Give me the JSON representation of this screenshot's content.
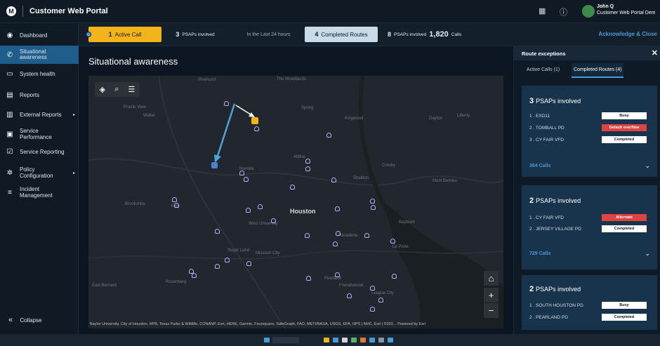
{
  "app": {
    "title": "Customer Web Portal"
  },
  "user": {
    "name": "John Q",
    "org": "Customer Web Portal Dem"
  },
  "sidebar": {
    "items": [
      {
        "label": "Dashboard"
      },
      {
        "label": "Situational awareness"
      },
      {
        "label": "System health"
      },
      {
        "label": "Reports"
      },
      {
        "label": "External Reports"
      },
      {
        "label": "Service Performance"
      },
      {
        "label": "Service Reporting"
      },
      {
        "label": "Policy Configuration"
      },
      {
        "label": "Incident Management"
      }
    ],
    "collapse_label": "Collapse"
  },
  "statusbar": {
    "active_count": "1",
    "active_label": "Active Call",
    "psaps_count": "3",
    "psaps_label": "PSAPs involved",
    "period": "In the Last 24 hours",
    "completed_count": "4",
    "completed_label": "Completed Routes",
    "completed_psaps_count": "8",
    "completed_psaps_label": "PSAPs involved",
    "calls_count": "1,820",
    "calls_label": "Calls",
    "acknowledge": "Acknowledge & Close"
  },
  "main": {
    "title": "Situational awareness"
  },
  "map": {
    "city_label": "Houston",
    "attribution": "Baylor University, City of Houston, HPB, Texas Parks & Wildlife, CONANP, Esri, HERE, Garmin, Foursquare, SafeGraph, FAO, METI/NASA, USGS, EPA, NPS | NHC, Esri | ©201... Powered by Esri",
    "labels": [
      "Pinehurst",
      "The Woodlands",
      "Prairie View",
      "Waller",
      "Spring",
      "Kingwood",
      "Dayton",
      "Liberty",
      "Aldine",
      "Crosby",
      "Humble",
      "Sheldon",
      "Mont Belvieu",
      "Brookshire",
      "Katy",
      "Baytown",
      "West University",
      "Pasadena",
      "La Porte",
      "Sugar Land",
      "Missouri City",
      "Pearland",
      "Friendswood",
      "League City",
      "Rosenberg",
      "East Bernard"
    ]
  },
  "panel": {
    "title": "Route exceptions",
    "tabs": [
      {
        "label": "Active Calls (1)"
      },
      {
        "label": "Completed Routes (4)"
      }
    ],
    "cards": [
      {
        "count": "3",
        "title": "PSAPs involved",
        "rows": [
          {
            "label": "1 . ESD11",
            "status": "Busy"
          },
          {
            "label": "2 . TOMBALL PD",
            "status": "Default overflow"
          },
          {
            "label": "3 . CY FAIR VFD",
            "status": "Completed"
          }
        ],
        "calls": "364 Calls"
      },
      {
        "count": "2",
        "title": "PSAPs involved",
        "rows": [
          {
            "label": "1 . CY FAIR VFD",
            "status": "Alternate"
          },
          {
            "label": "2 . JERSEY VILLAGE PD",
            "status": "Completed"
          }
        ],
        "calls": "729 Calls"
      },
      {
        "count": "2",
        "title": "PSAPs involved",
        "rows": [
          {
            "label": "1 . SOUTH HOUSTON PD",
            "status": "Busy"
          },
          {
            "label": "2 . PEARLAND PD",
            "status": "Completed"
          }
        ]
      }
    ]
  },
  "colors": {
    "accent": "#4a9ad6",
    "active": "#f3b41b",
    "alert": "#e04141",
    "nav_active": "#1f5d8c"
  }
}
